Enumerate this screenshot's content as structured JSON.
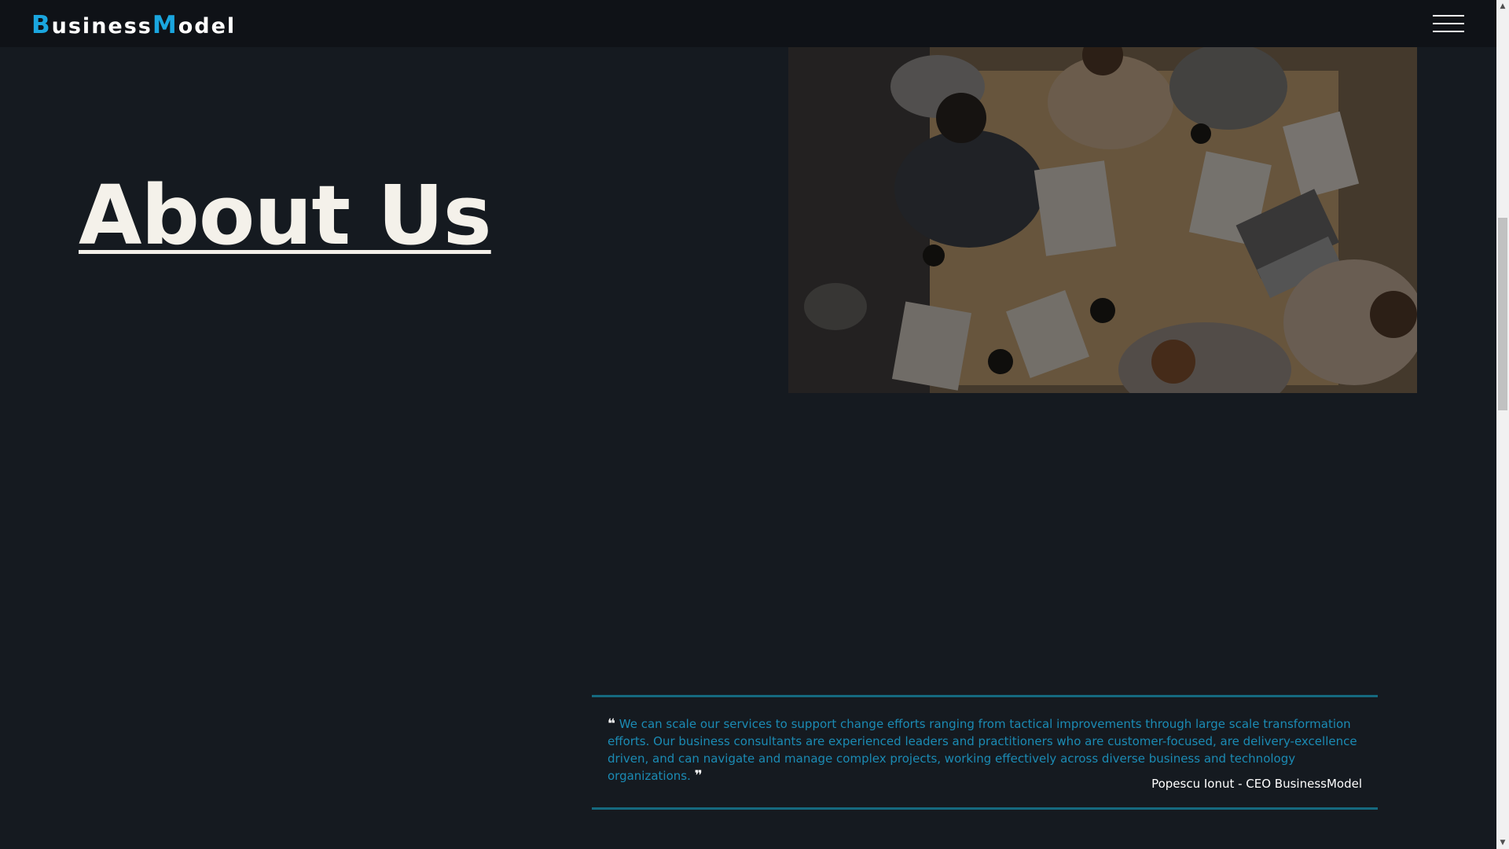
{
  "navbar": {
    "logo": {
      "part1_initial": "B",
      "part1_rest": "usiness",
      "part2_initial": "M",
      "part2_rest": "odel"
    },
    "menu_icon": "hamburger-menu-icon"
  },
  "hero": {
    "heading": "About Us",
    "photo_alt": "Business team meeting around a wooden table, viewed from above"
  },
  "quote": {
    "open_mark": "❝",
    "text": "We can scale our services to support change efforts ranging from tactical improvements through large scale transformation efforts. Our business consultants are experienced leaders and practitioners who are customer-focused, are delivery-excellence driven, and can navigate and manage complex projects, working effectively across diverse business and technology organizations.",
    "close_mark": "❞",
    "author": "Popescu Ionut - CEO BusinessModel"
  },
  "colors": {
    "background": "#151a20",
    "navbar": "#0f1217",
    "accent": "#1aa6df",
    "quote_text": "#1b8bb4",
    "quote_border": "#15697f",
    "heading": "#f4f1ea"
  }
}
